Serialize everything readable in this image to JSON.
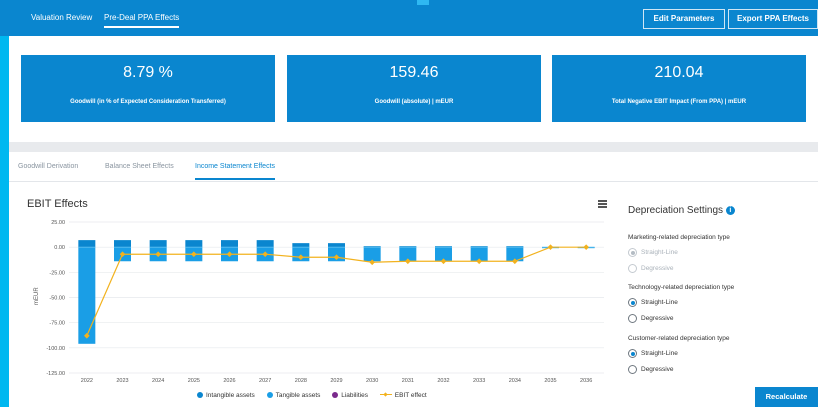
{
  "header": {
    "tabs": [
      {
        "label": "Valuation Review"
      },
      {
        "label": "Pre-Deal PPA Effects"
      }
    ],
    "edit_button": "Edit Parameters",
    "export_button": "Export PPA Effects"
  },
  "kpis": [
    {
      "value": "8.79 %",
      "label": "Goodwill (in % of Expected Consideration Transferred)"
    },
    {
      "value": "159.46",
      "label": "Goodwill (absolute) | mEUR"
    },
    {
      "value": "210.04",
      "label": "Total Negative EBIT Impact (From PPA) | mEUR"
    }
  ],
  "subtabs": [
    {
      "label": "Goodwill Derivation"
    },
    {
      "label": "Balance Sheet Effects"
    },
    {
      "label": "Income Statement Effects"
    }
  ],
  "chart_title": "EBIT Effects",
  "colors": {
    "brand": "#0a86cf",
    "intangible": "#0a86cf",
    "tangible": "#1a9ee6",
    "liabilities": "#7a2a8c",
    "ebit": "#f2b21e"
  },
  "chart_data": {
    "type": "bar",
    "categories": [
      "2022",
      "2023",
      "2024",
      "2025",
      "2026",
      "2027",
      "2028",
      "2029",
      "2030",
      "2031",
      "2032",
      "2033",
      "2034",
      "2035",
      "2036"
    ],
    "ylabel": "mEUR",
    "ylim": [
      -125,
      25
    ],
    "yticks": [
      "25.00",
      "0.00",
      "-25.00",
      "-50.00",
      "-75.00",
      "-100.00",
      "-125.00"
    ],
    "series": [
      {
        "name": "Intangible assets",
        "values": [
          7,
          7,
          7,
          7,
          7,
          7,
          4,
          4,
          1,
          1,
          1,
          1,
          1,
          0,
          0
        ]
      },
      {
        "name": "Tangible assets",
        "values": [
          -96,
          -14,
          -14,
          -14,
          -14,
          -14,
          -14,
          -14,
          -14,
          -14,
          -14,
          -14,
          -14,
          -1,
          -1
        ]
      },
      {
        "name": "Liabilities",
        "values": [
          0,
          0,
          0,
          0,
          0,
          0,
          0,
          0,
          0,
          0,
          0,
          0,
          0,
          0,
          0
        ]
      },
      {
        "name": "EBIT effect",
        "type": "line",
        "values": [
          -88,
          -7,
          -7,
          -7,
          -7,
          -7,
          -10,
          -10,
          -15,
          -14,
          -14,
          -14,
          -14,
          0,
          0
        ]
      }
    ],
    "legend": "bottom"
  },
  "settings": {
    "title": "Depreciation Settings",
    "info_icon": "i",
    "groups": [
      {
        "label": "Marketing-related depreciation type",
        "disabled": true,
        "options": [
          {
            "label": "Straight-Line",
            "selected": true
          },
          {
            "label": "Degressive",
            "selected": false
          }
        ]
      },
      {
        "label": "Technology-related depreciation type",
        "disabled": false,
        "options": [
          {
            "label": "Straight-Line",
            "selected": true
          },
          {
            "label": "Degressive",
            "selected": false
          }
        ]
      },
      {
        "label": "Customer-related depreciation type",
        "disabled": false,
        "options": [
          {
            "label": "Straight-Line",
            "selected": true
          },
          {
            "label": "Degressive",
            "selected": false
          }
        ]
      }
    ],
    "recalculate_button": "Recalculate"
  }
}
